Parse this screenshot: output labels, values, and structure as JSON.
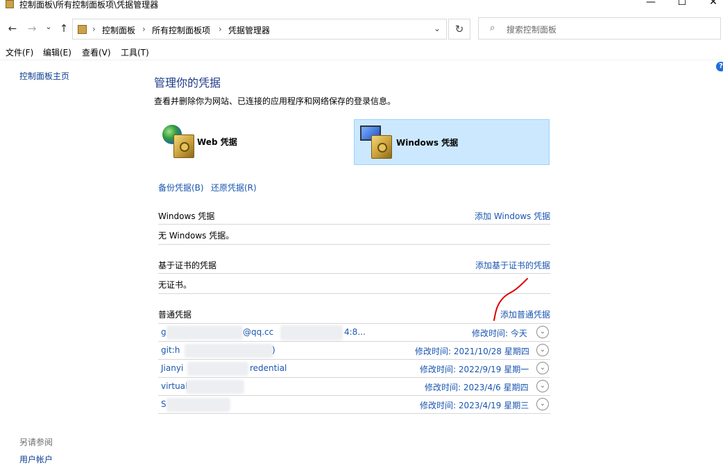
{
  "window": {
    "title": "控制面板\\所有控制面板项\\凭据管理器",
    "min_glyph": "—",
    "max_glyph": "☐",
    "close_glyph": "✕"
  },
  "nav": {
    "back_glyph": "←",
    "forward_glyph": "→",
    "recent_glyph": "⌄",
    "up_glyph": "↑",
    "breadcrumbs": [
      "控制面板",
      "所有控制面板项",
      "凭据管理器"
    ],
    "crumb_sep": "›",
    "dropdown_glyph": "⌄",
    "refresh_glyph": "↻",
    "search_placeholder": "搜索控制面板",
    "search_glyph": "⌕"
  },
  "menu": [
    "文件(F)",
    "编辑(E)",
    "查看(V)",
    "工具(T)"
  ],
  "left": {
    "home_link": "控制面板主页",
    "see_also_label": "另请参阅",
    "user_accounts_link": "用户帐户"
  },
  "help_glyph": "?",
  "main": {
    "title": "管理你的凭据",
    "description": "查看并删除你为网站、已连接的应用程序和网络保存的登录信息。",
    "cards": {
      "web_label": "Web 凭据",
      "windows_label": "Windows 凭据",
      "selected": "windows"
    },
    "backup_link": "备份凭据(B)",
    "restore_link": "还原凭据(R)",
    "windows_section": {
      "title": "Windows 凭据",
      "add_link": "添加 Windows 凭据",
      "empty_text": "无 Windows 凭据。"
    },
    "cert_section": {
      "title": "基于证书的凭据",
      "add_link": "添加基于证书的凭据",
      "empty_text": "无证书。"
    },
    "generic_section": {
      "title": "普通凭据",
      "add_link": "添加普通凭据"
    },
    "credentials": [
      {
        "name": "g",
        "name_tail": "@qq.cc",
        "name_tail2": "4:8...",
        "modified": "修改时间:  今天"
      },
      {
        "name": "git:h",
        "name_tail": ")",
        "modified": "修改时间:  2021/10/28 星期四"
      },
      {
        "name": "Jianyi",
        "name_tail": "redential",
        "modified": "修改时间:  2022/9/19 星期一"
      },
      {
        "name": "virtual",
        "name_tail": "",
        "modified": "修改时间:  2023/4/6 星期四"
      },
      {
        "name": "S",
        "name_tail": "",
        "modified": "修改时间:  2023/4/19 星期三"
      }
    ],
    "expand_glyph": "⌄"
  },
  "colors": {
    "link": "#1a56b0",
    "title": "#1e3a8a",
    "selected_bg": "#cce8ff",
    "annotation": "#e00000"
  }
}
